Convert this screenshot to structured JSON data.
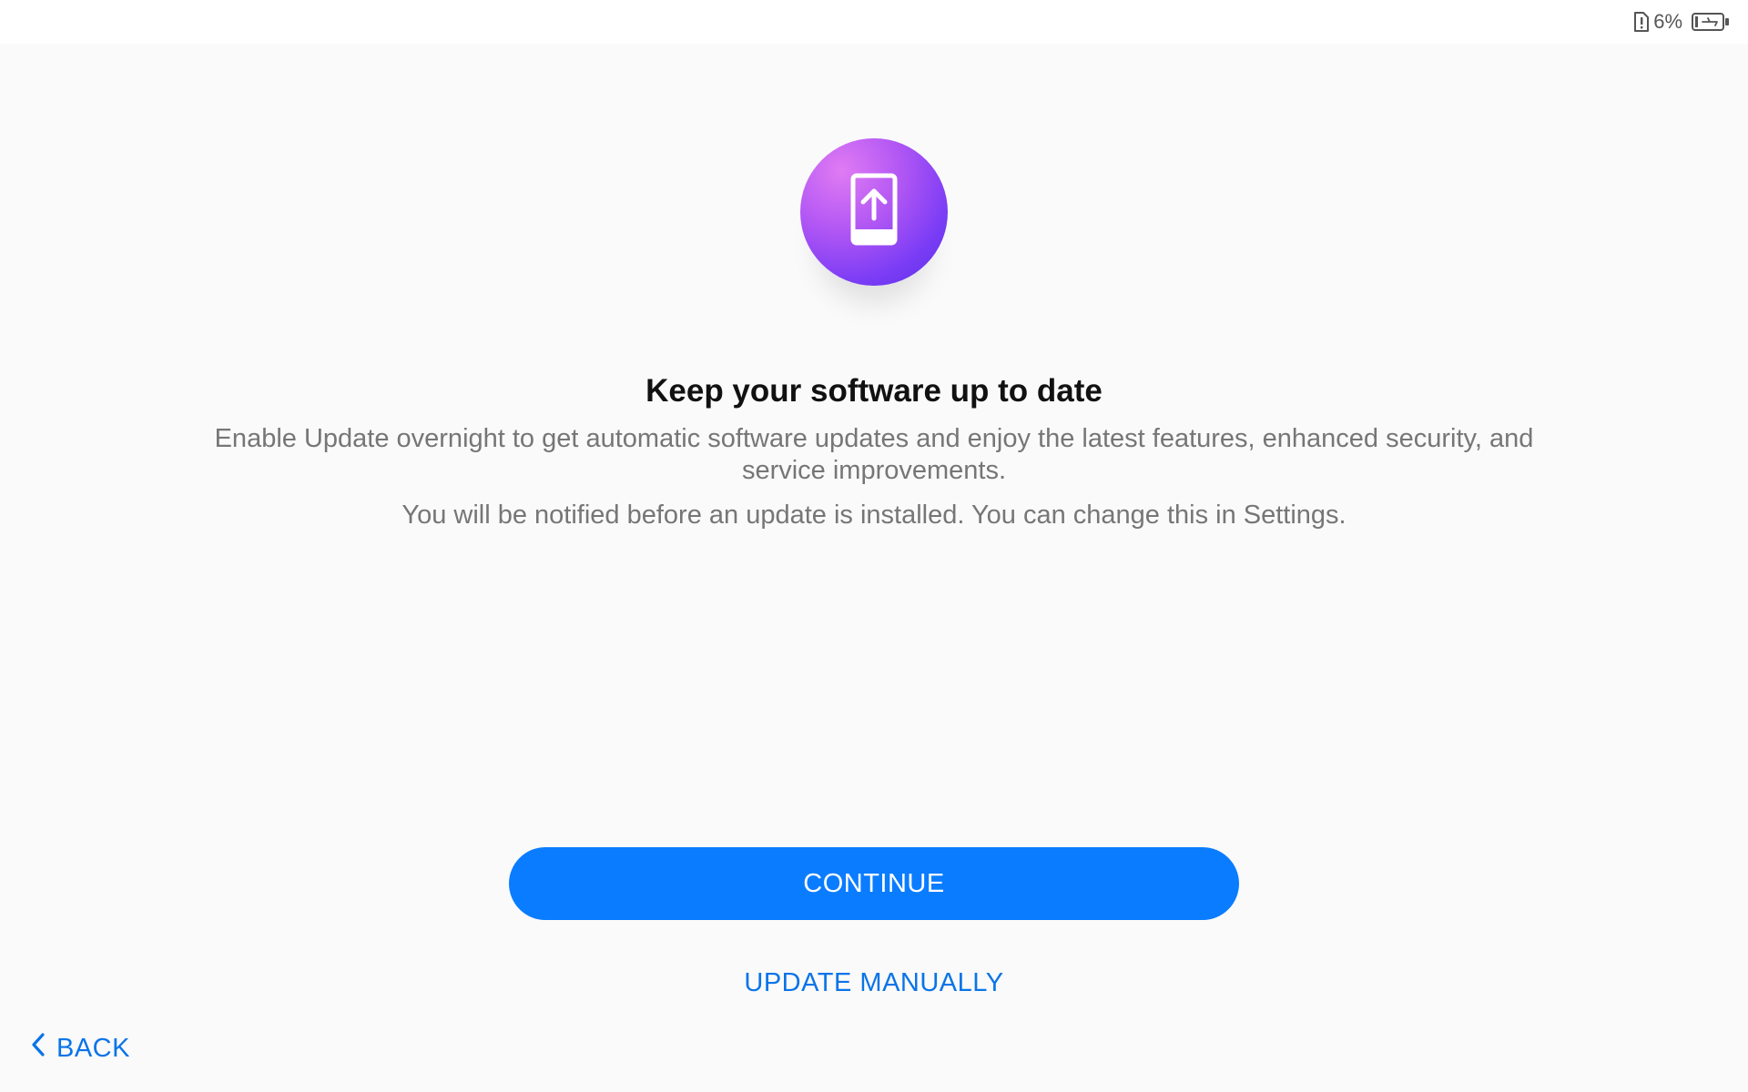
{
  "status_bar": {
    "battery_percent": "6%",
    "icons": [
      "battery-alert-icon",
      "battery-charging-icon"
    ]
  },
  "hero": {
    "icon": "tablet-upload-icon",
    "gradient": [
      "#e07bf3",
      "#b257f4",
      "#7a3cf5",
      "#5a2fe6"
    ]
  },
  "content": {
    "title": "Keep your software up to date",
    "description": "Enable Update overnight to get automatic software updates and enjoy the latest features, enhanced security, and service improvements.",
    "note": "You will be notified before an update is installed. You can change this in Settings."
  },
  "actions": {
    "continue_label": "CONTINUE",
    "manual_label": "UPDATE MANUALLY",
    "back_label": "BACK",
    "back_icon": "chevron-left-icon",
    "accent_color": "#0a7cff"
  }
}
